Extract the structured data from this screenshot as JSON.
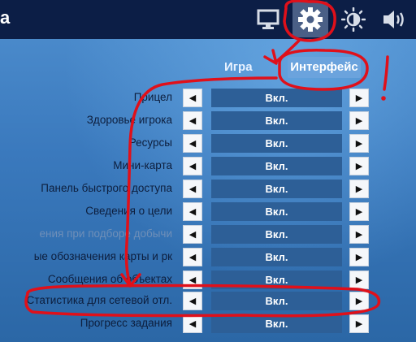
{
  "header": {
    "title": "а",
    "icons": [
      "monitor-icon",
      "gear-icon",
      "brightness-icon",
      "speaker-icon"
    ]
  },
  "tabs": [
    {
      "label": "Игра"
    },
    {
      "label": "Интерфейс"
    }
  ],
  "settings": [
    {
      "label": "Прицел",
      "value": "Вкл."
    },
    {
      "label": "Здоровье игрока",
      "value": "Вкл."
    },
    {
      "label": "Ресурсы",
      "value": "Вкл."
    },
    {
      "label": "Мини-карта",
      "value": "Вкл."
    },
    {
      "label": "Панель быстрого доступа",
      "value": "Вкл."
    },
    {
      "label": "Сведения о цели",
      "value": "Вкл."
    },
    {
      "label": "ения при подборе добычи",
      "value": "Вкл."
    },
    {
      "label": "ые обозначения карты и рк",
      "value": "Вкл."
    },
    {
      "label": "Сообщения об объектах",
      "value": "Вкл."
    },
    {
      "label": "Статистика для сетевой отл.",
      "value": "Вкл."
    },
    {
      "label": "Прогресс задания",
      "value": "Вкл."
    }
  ],
  "arrows": {
    "left": "◀",
    "right": "▶"
  },
  "annotation": {
    "mark": "!"
  },
  "colors": {
    "topbar": "#0c1e46",
    "value_bg": "#2d5f97",
    "annotation": "#e0101a"
  }
}
